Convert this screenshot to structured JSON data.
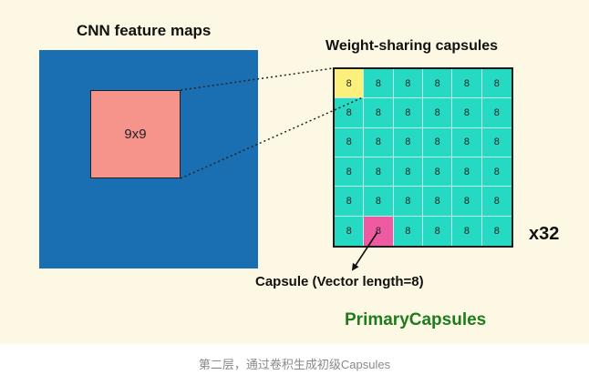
{
  "diagram": {
    "cnn_title": "CNN feature maps",
    "receptive_field_label": "9x9",
    "weight_sharing_title": "Weight-sharing capsules",
    "grid": {
      "rows": 6,
      "cols": 6,
      "cell_value": "8",
      "base_color": "#26d9c2",
      "highlight_yellow": {
        "row": 0,
        "col": 0,
        "color": "#fbf07b"
      },
      "highlight_pink": {
        "row": 5,
        "col": 1,
        "color": "#ee5ba2"
      }
    },
    "multiplier": "x32",
    "capsule_label": "Capsule (Vector length=8)",
    "primary_label": "PrimaryCapsules",
    "feature_map_color": "#1a6fb3",
    "receptive_field_color": "#f6938b"
  },
  "caption": "第二层，通过卷积生成初级Capsules"
}
